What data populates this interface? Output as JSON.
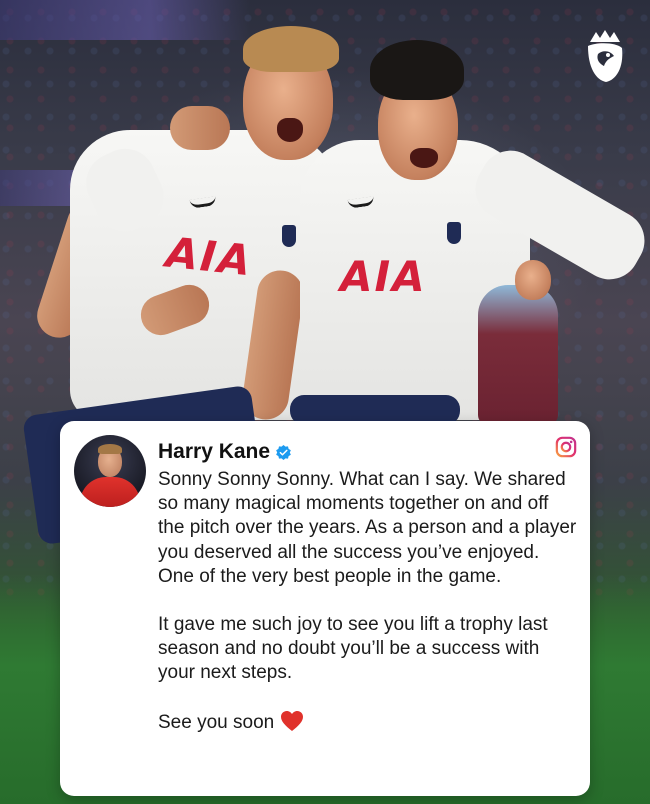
{
  "post": {
    "author": "Harry Kane",
    "verified_icon": "verified-badge-icon",
    "platform_icon": "instagram-icon",
    "paragraphs": [
      "Sonny Sonny Sonny. What can I say. We shared so many magical moments together on and off the pitch over the years. As a person and a player you deserved all the success you’ve enjoyed. One of the very best people in the game.",
      "It gave me such joy to see you lift a trophy last season and no doubt you’ll be a success with your next steps."
    ],
    "closing": "See you soon",
    "closing_icon": "red-heart-icon"
  },
  "photo": {
    "sponsor_left": "AIA",
    "sponsor_right": "AIA",
    "league_logo": "premier-league-lion-icon"
  },
  "colors": {
    "instagram_gradient_start": "#f9a03f",
    "instagram_gradient_end": "#c2348f",
    "verified_blue": "#1d9bf0",
    "heart_red": "#e0312b",
    "sponsor_red": "#d4203a",
    "card_background": "#ffffff"
  }
}
